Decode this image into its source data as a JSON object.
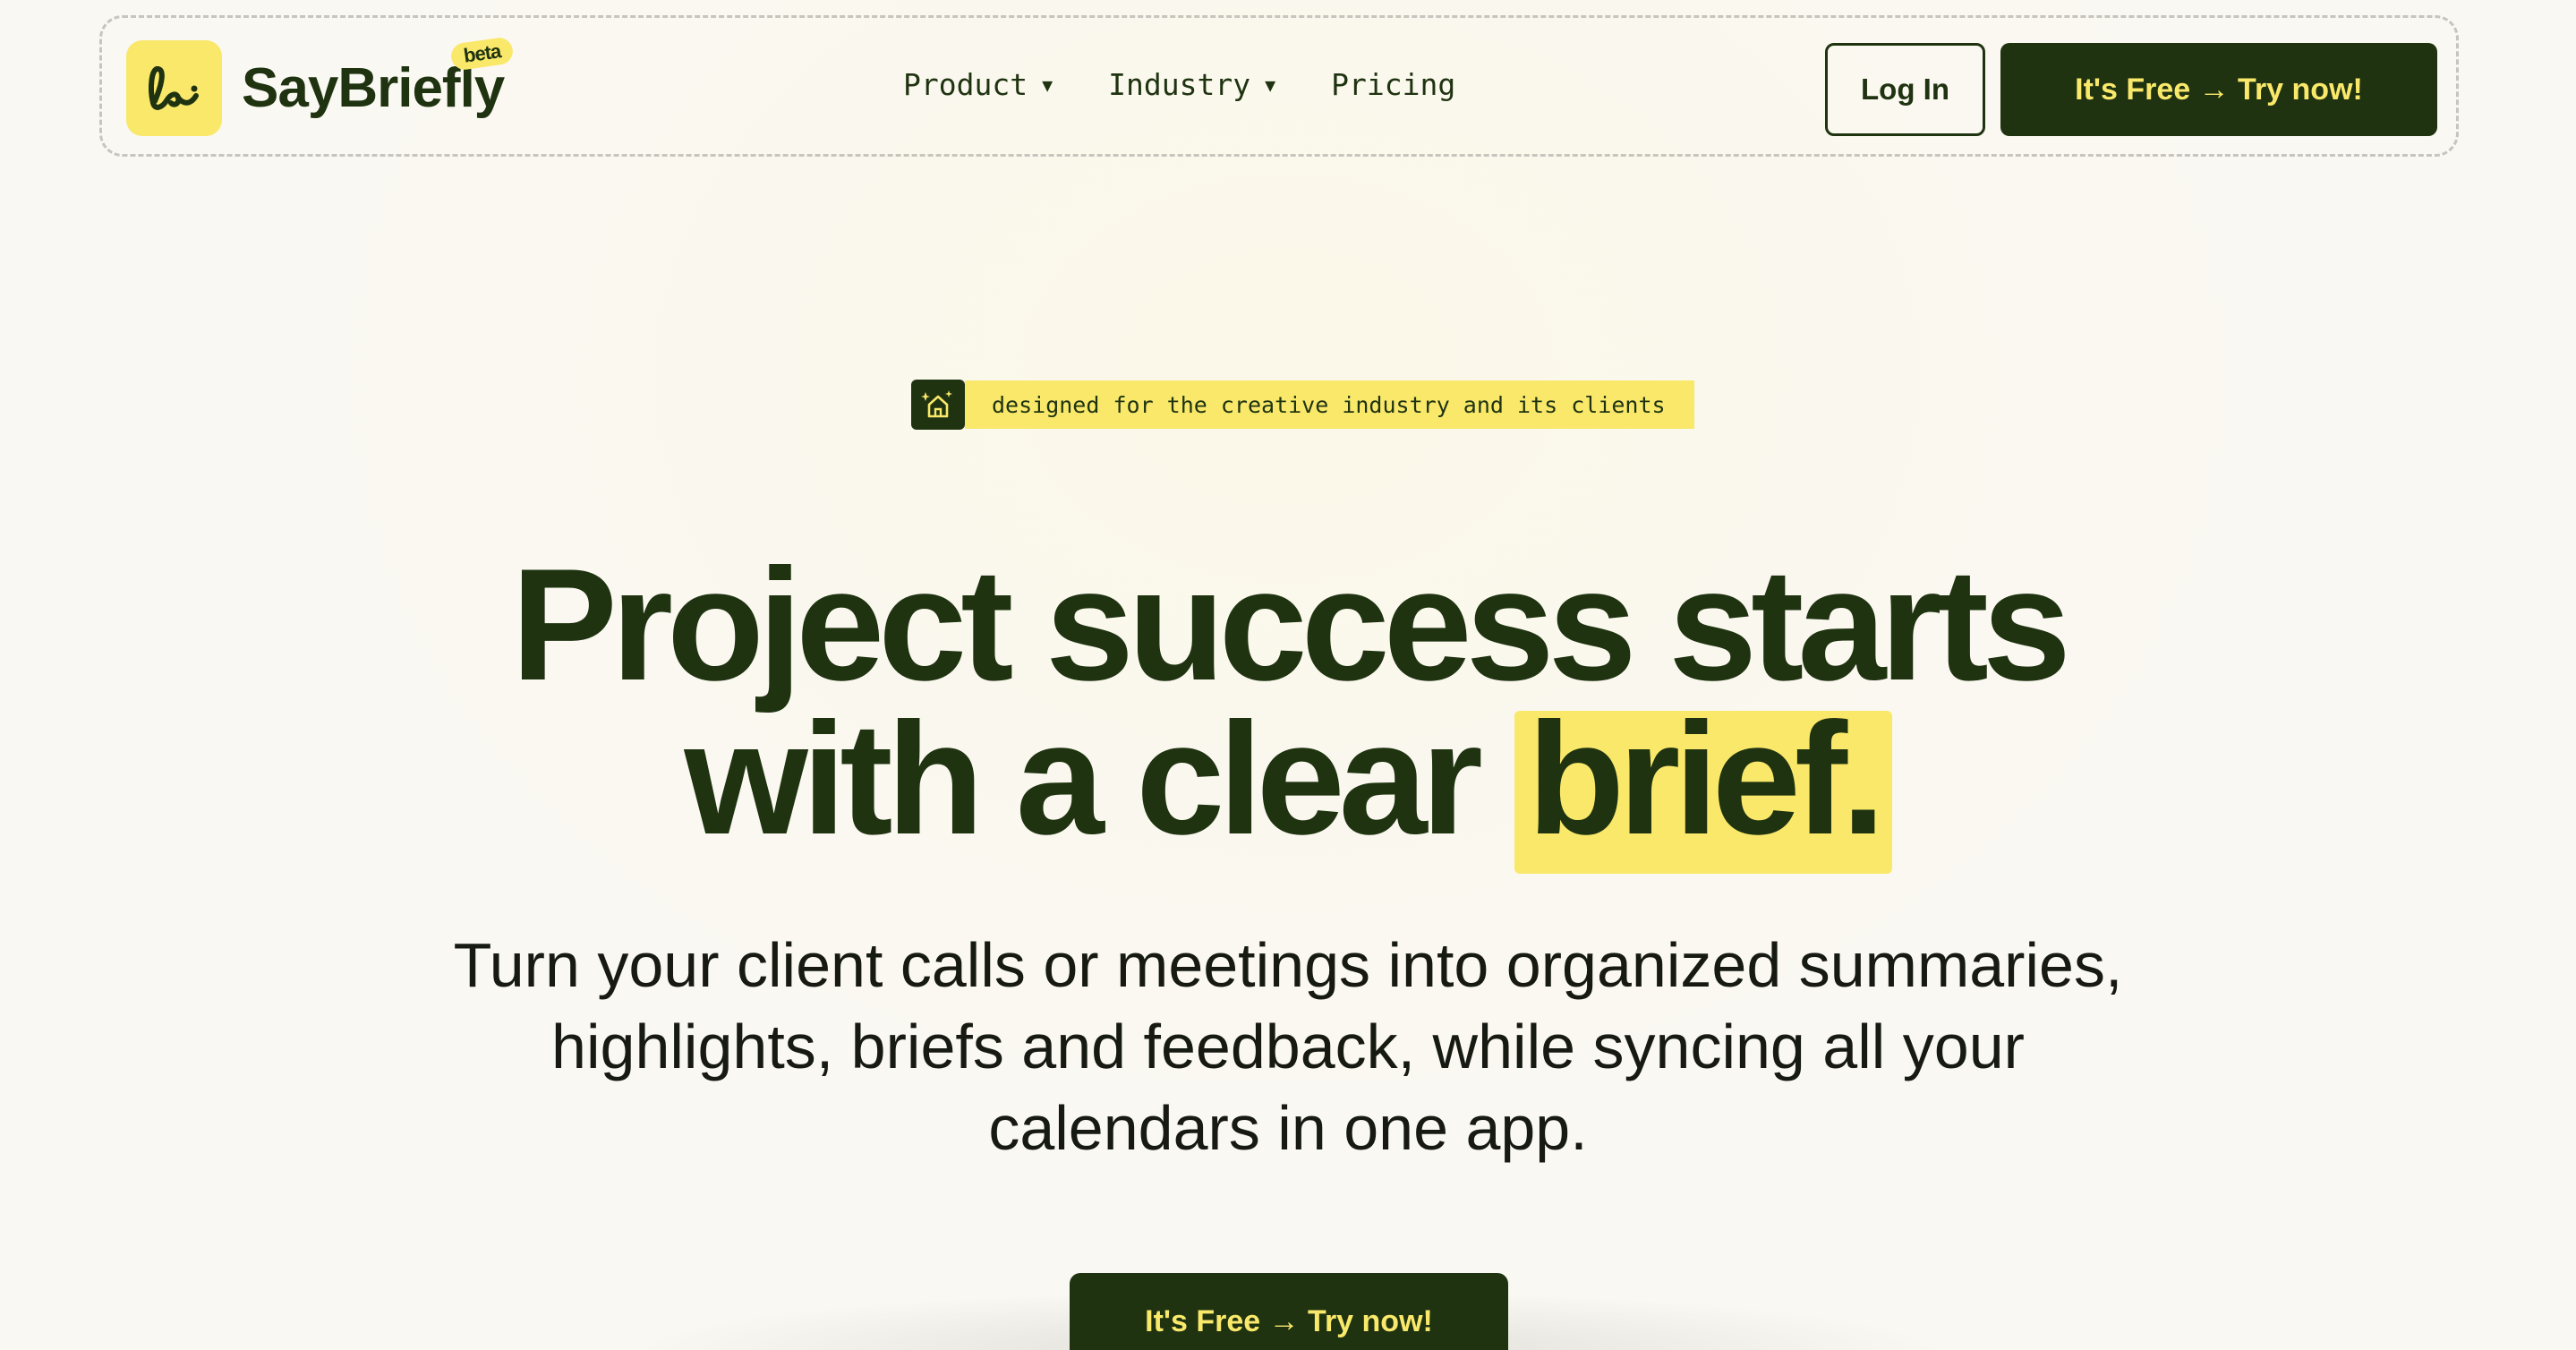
{
  "brand": {
    "name": "SayBriefly",
    "badge": "beta",
    "logo_icon": "signature-b-icon"
  },
  "nav": {
    "items": [
      {
        "label": "Product",
        "has_dropdown": true
      },
      {
        "label": "Industry",
        "has_dropdown": true
      },
      {
        "label": "Pricing",
        "has_dropdown": false
      }
    ],
    "caret": "▼",
    "login_label": "Log In",
    "try_label": "It's Free → Try now!"
  },
  "hero": {
    "tag_icon": "magic-house-sparkle-icon",
    "tag_text": "designed for the creative industry and its clients",
    "headline_line1": "Project success starts",
    "headline_line2_pre": "with a clear ",
    "headline_highlight": "brief.",
    "subtext_lines": [
      "Turn your client calls or meetings into organized summaries,",
      "highlights, briefs and feedback, while syncing all your",
      "calendars in one app."
    ],
    "cta_label": "It's Free → Try now!"
  },
  "colors": {
    "accent": "#f9e86a",
    "primary": "#1f3311",
    "background": "#faf8f2",
    "border_dashed": "#c7c5bd"
  }
}
